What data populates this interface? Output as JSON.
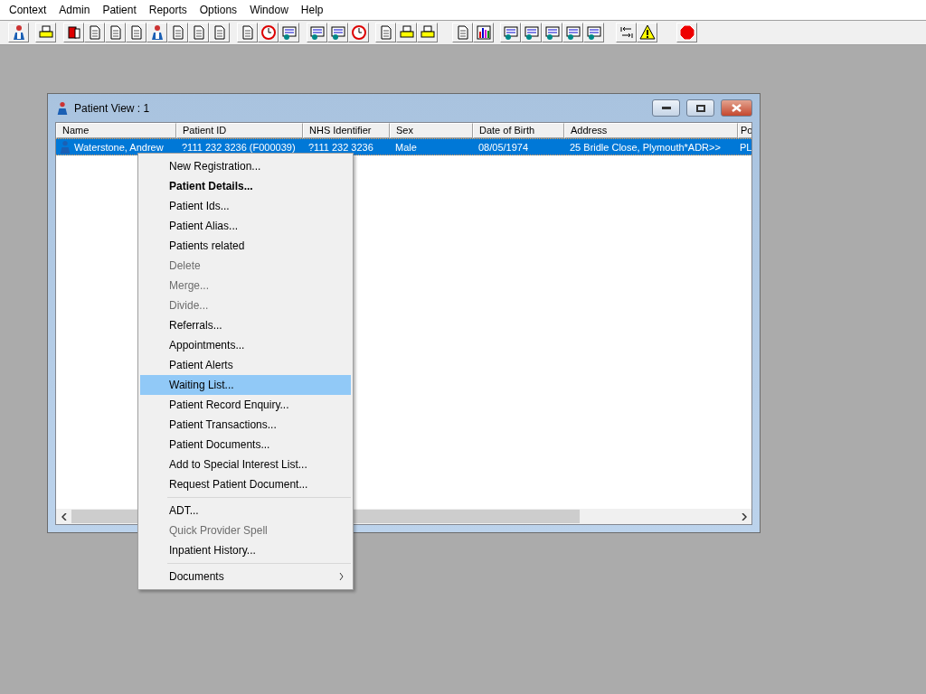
{
  "menu_bar": [
    "Context",
    "Admin",
    "Patient",
    "Reports",
    "Options",
    "Window",
    "Help"
  ],
  "window": {
    "title": "Patient View : 1"
  },
  "table": {
    "columns": [
      "Name",
      "Patient ID",
      "NHS Identifier",
      "Sex",
      "Date of Birth",
      "Address",
      "Po"
    ],
    "rows": [
      {
        "selected": true,
        "cells": [
          "Waterstone, Andrew",
          "?111 232 3236 (F000039)",
          "?111 232 3236",
          "Male",
          "08/05/1974",
          "25 Bridle Close, Plymouth*ADR>>",
          "PL"
        ]
      }
    ]
  },
  "context_menu": [
    {
      "kind": "item",
      "label": "New Registration...",
      "disabled": false,
      "selected": false,
      "default": false
    },
    {
      "kind": "item",
      "label": "Patient Details...",
      "disabled": false,
      "selected": false,
      "default": true
    },
    {
      "kind": "item",
      "label": "Patient Ids...",
      "disabled": false,
      "selected": false,
      "default": false
    },
    {
      "kind": "item",
      "label": "Patient Alias...",
      "disabled": false,
      "selected": false,
      "default": false
    },
    {
      "kind": "item",
      "label": "Patients related",
      "disabled": false,
      "selected": false,
      "default": false
    },
    {
      "kind": "item",
      "label": "Delete",
      "disabled": true,
      "selected": false,
      "default": false
    },
    {
      "kind": "item",
      "label": "Merge...",
      "disabled": true,
      "selected": false,
      "default": false
    },
    {
      "kind": "item",
      "label": "Divide...",
      "disabled": true,
      "selected": false,
      "default": false
    },
    {
      "kind": "item",
      "label": "Referrals...",
      "disabled": false,
      "selected": false,
      "default": false
    },
    {
      "kind": "item",
      "label": "Appointments...",
      "disabled": false,
      "selected": false,
      "default": false
    },
    {
      "kind": "item",
      "label": "Patient Alerts",
      "disabled": false,
      "selected": false,
      "default": false
    },
    {
      "kind": "item",
      "label": "Waiting List...",
      "disabled": false,
      "selected": true,
      "default": false
    },
    {
      "kind": "item",
      "label": "Patient Record Enquiry...",
      "disabled": false,
      "selected": false,
      "default": false
    },
    {
      "kind": "item",
      "label": "Patient Transactions...",
      "disabled": false,
      "selected": false,
      "default": false
    },
    {
      "kind": "item",
      "label": "Patient Documents...",
      "disabled": false,
      "selected": false,
      "default": false
    },
    {
      "kind": "item",
      "label": "Add to Special Interest List...",
      "disabled": false,
      "selected": false,
      "default": false
    },
    {
      "kind": "item",
      "label": "Request Patient Document...",
      "disabled": false,
      "selected": false,
      "default": false
    },
    {
      "kind": "separator"
    },
    {
      "kind": "item",
      "label": "ADT...",
      "disabled": false,
      "selected": false,
      "default": false
    },
    {
      "kind": "item",
      "label": "Quick Provider Spell",
      "disabled": true,
      "selected": false,
      "default": false
    },
    {
      "kind": "item",
      "label": "Inpatient History...",
      "disabled": false,
      "selected": false,
      "default": false
    },
    {
      "kind": "separator"
    },
    {
      "kind": "submenu",
      "label": "Documents",
      "disabled": false,
      "selected": false,
      "default": false
    }
  ]
}
